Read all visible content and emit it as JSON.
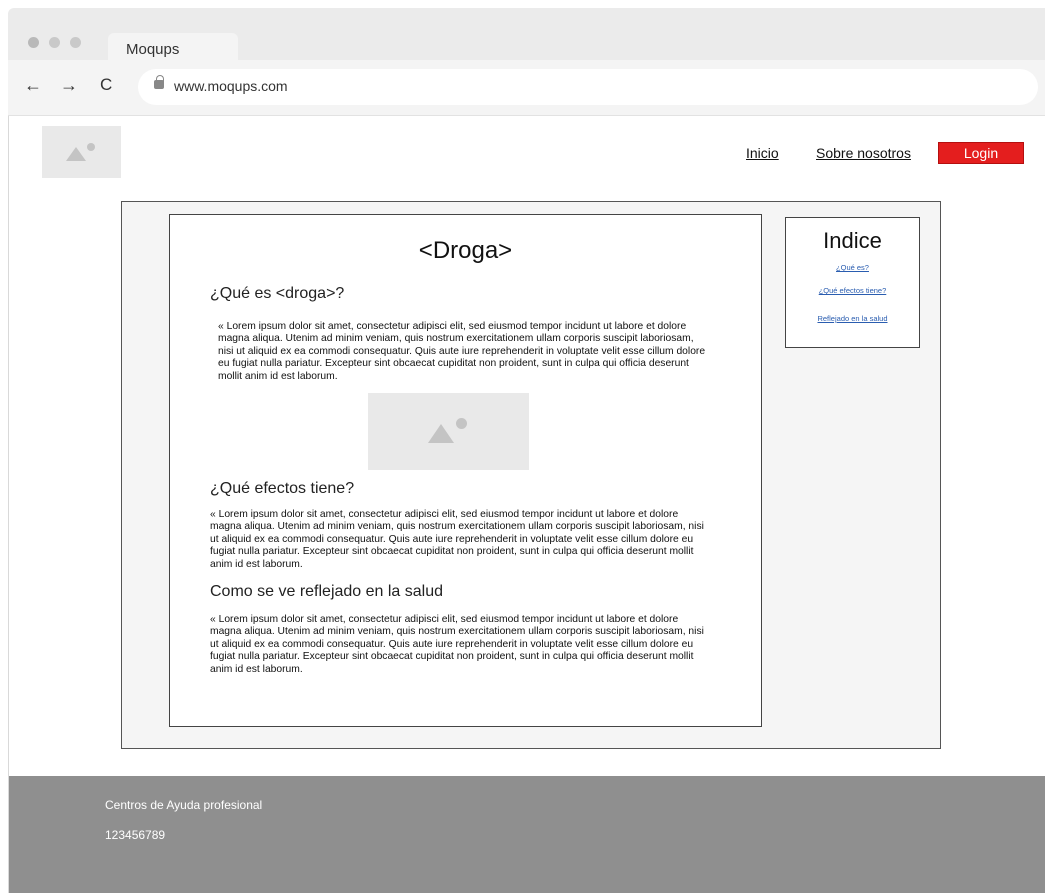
{
  "browser": {
    "tab_title": "Moqups",
    "url": "www.moqups.com",
    "back_icon": "←",
    "forward_icon": "→",
    "reload_icon": "C"
  },
  "header": {
    "nav": {
      "inicio": "Inicio",
      "sobre_nosotros": "Sobre nosotros",
      "login": "Login"
    },
    "accent_color": "#e41e1e"
  },
  "article": {
    "title": "<Droga>",
    "sections": [
      {
        "heading": "¿Qué es <droga>?",
        "text": "« Lorem ipsum dolor sit amet, consectetur adipisci elit, sed eiusmod tempor incidunt ut labore et dolore magna aliqua. Utenim ad minim veniam, quis nostrum exercitationem ullam corporis suscipit laboriosam, nisi ut aliquid ex ea commodi consequatur. Quis aute iure reprehenderit in voluptate velit esse cillum dolore eu fugiat nulla pariatur. Excepteur sint obcaecat cupiditat non proident, sunt in culpa qui officia deserunt mollit anim id est laborum."
      },
      {
        "heading": "¿Qué efectos tiene?",
        "text": "« Lorem ipsum dolor sit amet, consectetur adipisci elit, sed eiusmod tempor incidunt ut labore et dolore magna aliqua. Utenim ad minim veniam, quis nostrum exercitationem ullam corporis suscipit laboriosam, nisi ut aliquid ex ea commodi consequatur. Quis aute iure reprehenderit in voluptate velit esse cillum dolore eu fugiat nulla pariatur. Excepteur sint obcaecat cupiditat non proident, sunt in culpa qui officia deserunt mollit anim id est laborum."
      },
      {
        "heading": "Como se ve reflejado en la salud",
        "text": "« Lorem ipsum dolor sit amet, consectetur adipisci elit, sed eiusmod tempor incidunt ut labore et dolore magna aliqua. Utenim ad minim veniam, quis nostrum exercitationem ullam corporis suscipit laboriosam, nisi ut aliquid ex ea commodi consequatur. Quis aute iure reprehenderit in voluptate velit esse cillum dolore eu fugiat nulla pariatur. Excepteur sint obcaecat cupiditat non proident, sunt in culpa qui officia deserunt mollit anim id est laborum."
      }
    ]
  },
  "index": {
    "title": "Indice",
    "links": [
      "¿Qué es?",
      "¿Qué efectos tiene?",
      "Reflejado en la salud"
    ]
  },
  "footer": {
    "line1": "Centros de Ayuda profesional",
    "line2": "123456789"
  },
  "icons": {
    "logo_placeholder": "image-placeholder-icon",
    "article_image": "image-placeholder-icon"
  }
}
